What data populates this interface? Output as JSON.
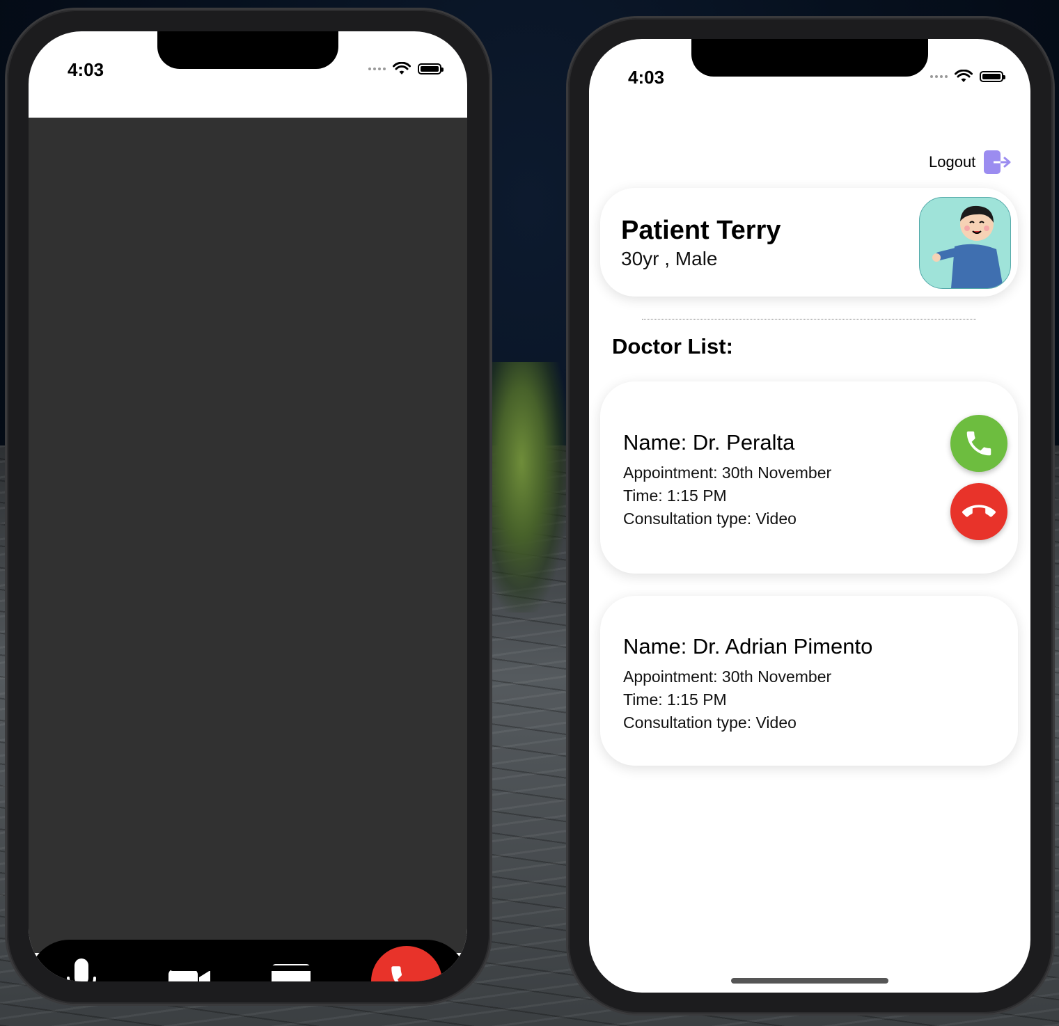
{
  "left_phone": {
    "status_time": "4:03"
  },
  "right_phone": {
    "status_time": "4:03",
    "logout_label": "Logout",
    "patient": {
      "name": "Patient Terry",
      "info": "30yr , Male"
    },
    "section_title": "Doctor List:",
    "doctors": [
      {
        "name": "Name: Dr. Peralta",
        "appointment": "Appointment: 30th November",
        "time": "Time: 1:15 PM",
        "consultation": "Consultation type: Video"
      },
      {
        "name": "Name: Dr. Adrian Pimento",
        "appointment": "Appointment: 30th November",
        "time": "Time: 1:15 PM",
        "consultation": "Consultation type: Video"
      }
    ]
  },
  "colors": {
    "accept_green": "#6dbd3f",
    "decline_red": "#e8332a",
    "video_bg": "#313131",
    "logout_accent": "#9b8cf0"
  },
  "icons": [
    "microphone-icon",
    "video-camera-icon",
    "chat-bubble-icon",
    "phone-end-icon",
    "logout-icon",
    "phone-accept-icon",
    "phone-decline-icon",
    "wifi-icon",
    "battery-icon"
  ]
}
